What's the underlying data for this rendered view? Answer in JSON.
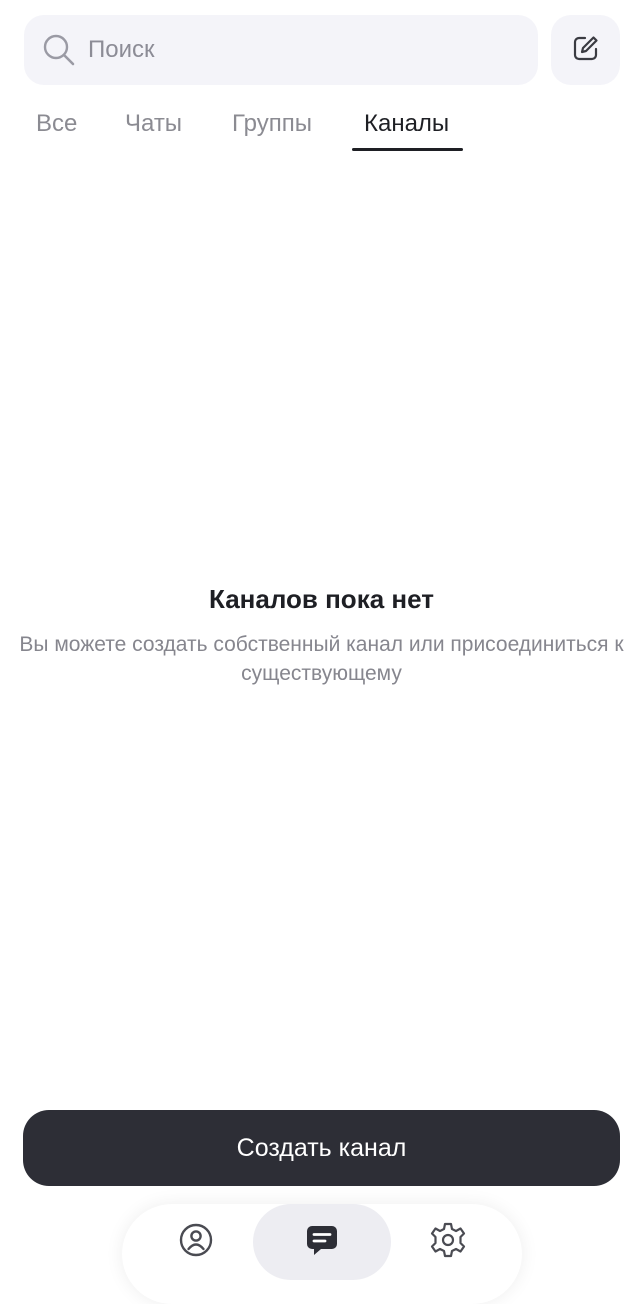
{
  "search": {
    "placeholder": "Поиск",
    "value": ""
  },
  "tabs": [
    {
      "label": "Все",
      "active": false
    },
    {
      "label": "Чаты",
      "active": false
    },
    {
      "label": "Группы",
      "active": false
    },
    {
      "label": "Каналы",
      "active": true
    }
  ],
  "empty_state": {
    "title": "Каналов пока нет",
    "description_line1": "Вы можете создать собственный канал или присоединиться к",
    "description_line2": "существующему"
  },
  "create_button": {
    "label": "Создать канал"
  },
  "bottom_nav": {
    "items": [
      {
        "icon": "profile-icon",
        "active": false
      },
      {
        "icon": "chat-icon",
        "active": true
      },
      {
        "icon": "gear-icon",
        "active": false
      }
    ]
  },
  "colors": {
    "background": "#ffffff",
    "field_bg": "#f4f4f9",
    "text_primary": "#1e1f24",
    "text_secondary": "#8b8b92",
    "button_bg": "#2d2e36",
    "button_text": "#ffffff"
  }
}
